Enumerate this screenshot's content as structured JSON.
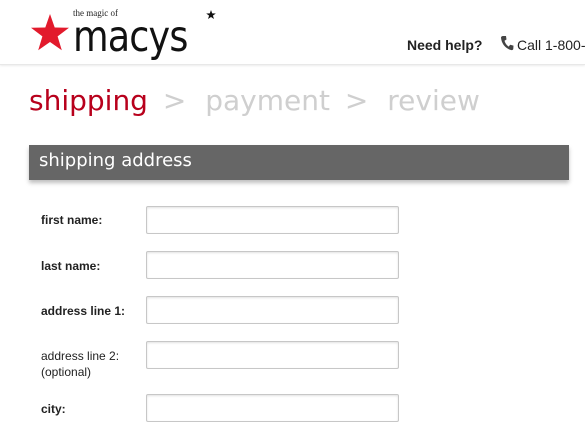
{
  "header": {
    "logo_tagline": "the magic of",
    "logo_wordmark": "macys",
    "help_label": "Need help?",
    "phone_text": "Call 1-800-",
    "brand_color": "#e21a2c"
  },
  "steps": [
    {
      "label": "shipping",
      "state": "active"
    },
    {
      "label": "payment",
      "state": "inactive"
    },
    {
      "label": "review",
      "state": "inactive"
    }
  ],
  "step_separator": ">",
  "section": {
    "title": "shipping address"
  },
  "form": {
    "first_name": {
      "label": "first name:",
      "value": ""
    },
    "last_name": {
      "label": "last name:",
      "value": ""
    },
    "address_line_1": {
      "label": "address line 1:",
      "value": ""
    },
    "address_line_2": {
      "label": "address line 2:",
      "sublabel": "(optional)",
      "value": ""
    },
    "city": {
      "label": "city:",
      "value": ""
    }
  },
  "colors": {
    "active_step": "#b8001c",
    "inactive_step": "#cfcfcf",
    "section_bar": "#666666"
  }
}
